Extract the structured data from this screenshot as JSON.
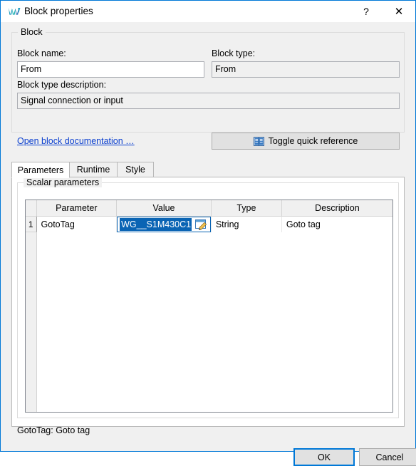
{
  "window": {
    "title": "Block properties",
    "icon": "app-logo-icon",
    "help_label": "?",
    "close_label": "✕",
    "accent_color": "#0078d7"
  },
  "block_group": {
    "legend": "Block",
    "block_name_label": "Block name:",
    "block_name_value": "From",
    "block_type_label": "Block type:",
    "block_type_value": "From",
    "block_type_description_label": "Block type description:",
    "block_type_description_value": "Signal connection or input"
  },
  "doc_link": {
    "label": "Open block documentation …",
    "color": "#0b3fcf"
  },
  "toggle_quickref": {
    "label": "Toggle quick reference",
    "icon": "book-icon"
  },
  "tabs": [
    {
      "label": "Parameters",
      "active": true
    },
    {
      "label": "Runtime",
      "active": false
    },
    {
      "label": "Style",
      "active": false
    }
  ],
  "scalar_group": {
    "legend": "Scalar parameters"
  },
  "table": {
    "corner_label": "",
    "columns": [
      "Parameter",
      "Value",
      "Type",
      "Description"
    ],
    "rows": [
      {
        "num": "1",
        "parameter": "GotoTag",
        "value": "WG__S1M430C1",
        "type": "String",
        "description": "Goto tag",
        "editing": true,
        "selection_color": "#0a64b4",
        "editor_icon": "edit-pencil-icon"
      }
    ]
  },
  "status": {
    "text": "GotoTag: Goto tag"
  },
  "dialog_buttons": {
    "ok_label": "OK",
    "cancel_label": "Cancel"
  }
}
